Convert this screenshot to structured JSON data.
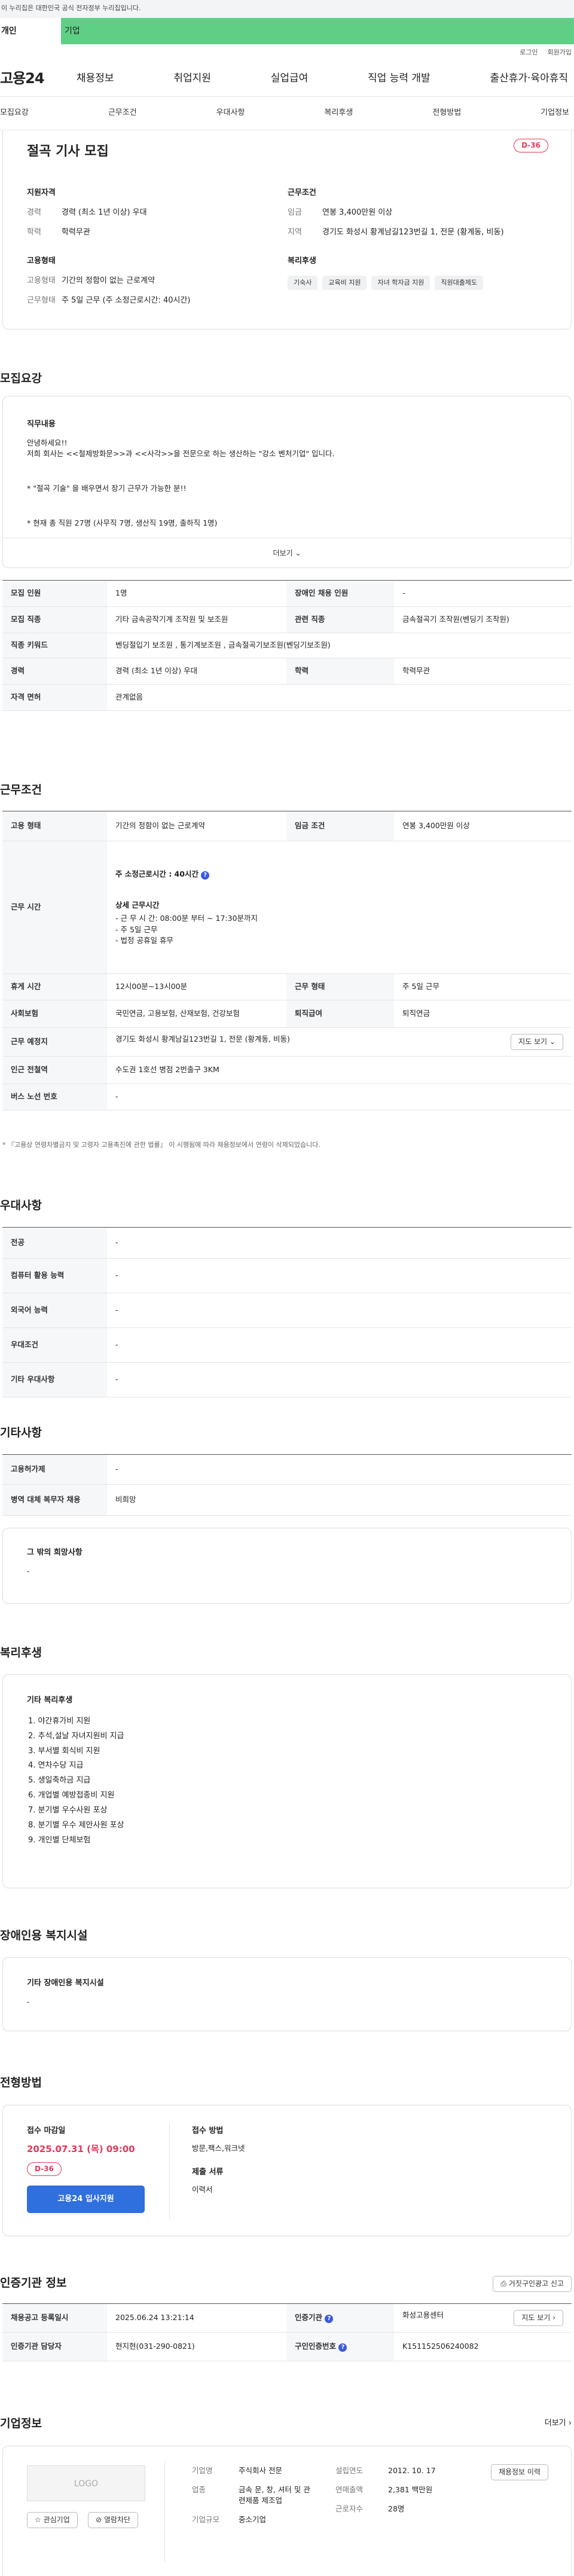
{
  "gov_banner": "이 누리집은 대한민국 공식 전자정부 누리집입니다.",
  "top_tabs": [
    "개인",
    "기업"
  ],
  "util_links": [
    "로그인",
    "회원가입"
  ],
  "site_logo": "고용24",
  "gnb": [
    "채용정보",
    "취업지원",
    "실업급여",
    "직업 능력 개발",
    "출산휴가·육아휴직"
  ],
  "anchors": [
    "모집요강",
    "근무조건",
    "우대사항",
    "복리후생",
    "전형방법",
    "기업정보"
  ],
  "job": {
    "title": "절곡 기사 모집",
    "dday": "D-36",
    "summary_left_title": "지원자격",
    "summary_left": [
      {
        "k": "경력",
        "v": "경력 (최소 1년 이상) 우대"
      },
      {
        "k": "학력",
        "v": "학력무관"
      }
    ],
    "employ_title": "고용형태",
    "employ": [
      {
        "k": "고용형태",
        "v": "기간의 정함이 없는 근로계약"
      },
      {
        "k": "근무형태",
        "v": "주 5일 근무 (주 소정근로시간: 40시간)"
      }
    ],
    "summary_right_title": "근무조건",
    "summary_right": [
      {
        "k": "임금",
        "v": "연봉 3,400만원 이상"
      },
      {
        "k": "지역",
        "v": "경기도 화성시 황계남길123번길 1, 전문 (황계동, 비동)"
      }
    ],
    "welfare_title": "복리후생",
    "welfare_chips": [
      "기숙사",
      "교육비 지원",
      "자녀 학자금 지원",
      "직원대출제도"
    ]
  },
  "recruit": {
    "heading": "모집요강",
    "duty_title": "직무내용",
    "duty_lines": [
      "안녕하세요!!",
      "저희 회사는 <<철제방화문>>과 <<사각>>을 전문으로 하는 생산하는 \"강소 벤처기업\" 입니다.",
      "* \"절곡 기술\" 을 배우면서 장기 근무가 가능한 분!!",
      "* 현재 총 직원 27명 (사무직 7명, 생산직 19명, 출하직 1명)"
    ],
    "more": "더보기",
    "rows": [
      [
        {
          "k": "모집 인원",
          "v": "1명"
        },
        {
          "k": "장애인 채용 인원",
          "v": "-"
        }
      ],
      [
        {
          "k": "모집 직종",
          "v": "기타 금속공작기계 조작원 및 보조원"
        },
        {
          "k": "관련 직종",
          "v": "금속절곡기 조작원(벤딩기 조작원)"
        }
      ],
      [
        {
          "k": "직종 키워드",
          "v": "벤딩절입기 보조원 , 통기계보조원 , 금속절곡기보조원(벤딩기보조원)"
        }
      ],
      [
        {
          "k": "경력",
          "v": "경력 (최소 1년 이상) 우대"
        },
        {
          "k": "학력",
          "v": "학력무관"
        }
      ],
      [
        {
          "k": "자격 면허",
          "v": "관계없음"
        }
      ]
    ]
  },
  "work": {
    "heading": "근무조건",
    "employ_k": "고용 형태",
    "employ_v": "기간의 정함이 없는 근로계약",
    "wage_k": "임금 조건",
    "wage_v": "연봉 3,400만원 이상",
    "hours_k": "근무 시간",
    "hours_weekly": "주 소정근로시간 : 40시간",
    "hours_detail_title": "상세 근무시간",
    "hours_detail": [
      "- 근 무 시 간: 08:00분 부터 ~ 17:30분까지",
      "- 주 5일 근무",
      "- 법정 공휴일 휴무"
    ],
    "rest_k": "휴게 시간",
    "rest_v": "12시00분~13시00분",
    "type_k": "근무 형태",
    "type_v": "주 5일 근무",
    "ins_k": "사회보험",
    "ins_v": "국민연금, 고용보험, 산재보험, 건강보험",
    "ret_k": "퇴직급여",
    "ret_v": "퇴직연금",
    "place_k": "근무 예정지",
    "place_v": "경기도 화성시 황계남길123번길 1, 전문 (황계동, 비동)",
    "map_btn": "지도 보기",
    "subway_k": "인근 전철역",
    "subway_v": "수도권 1호선 병점 2번출구 3KM",
    "bus_k": "버스 노선 번호",
    "bus_v": "-",
    "note": "* 『고용상 연령차별금지 및 고령자 고용촉진에 관한 법률』 이 시행됨에 따라 채용정보에서 연령이 삭제되었습니다."
  },
  "pref": {
    "heading": "우대사항",
    "rows": [
      {
        "k": "전공",
        "v": "-"
      },
      {
        "k": "컴퓨터 활용 능력",
        "v": "-"
      },
      {
        "k": "외국어 능력",
        "v": "-"
      },
      {
        "k": "우대조건",
        "v": "-"
      },
      {
        "k": "기타 우대사항",
        "v": "-"
      }
    ]
  },
  "etc": {
    "heading": "기타사항",
    "rows": [
      {
        "k": "고용허가제",
        "v": "-"
      },
      {
        "k": "병역 대체 복무자 채용",
        "v": "비희망"
      }
    ],
    "other_title": "그 밖의 희망사항",
    "other_v": "-"
  },
  "welfare": {
    "heading": "복리후생",
    "box_title": "기타 복리후생",
    "items": [
      "1. 야간휴가비 지원",
      "2. 추석,설날 자녀지원비 지급",
      "3. 부서별 회식비 지원",
      "4. 연차수당 지급",
      "5. 생일축하금 지급",
      "6. 개업별 예방접종비 지원",
      "7. 분기별 우수사원 포상",
      "8. 분기별 우수 제안사원 포상",
      "9. 개인별 단체보험"
    ]
  },
  "disabled": {
    "heading": "장애인용 복지시설",
    "box_title": "기타 장애인용 복지시설",
    "v": "-"
  },
  "selection": {
    "heading": "전형방법",
    "deadline_title": "접수 마감일",
    "deadline": "2025.07.31 (목) 09:00",
    "dday": "D-36",
    "apply_btn": "고용24 입사지원",
    "method_title": "접수 방법",
    "method_v": "방문,팩스,워크넷",
    "docs_title": "제출 서류",
    "docs_v": "이력서"
  },
  "cert": {
    "heading": "인증기관 정보",
    "report_btn": "거짓구인광고 신고",
    "reg_k": "채용공고 등록일시",
    "reg_v": "2025.06.24 13:21:14",
    "org_k": "인증기관",
    "org_v": "화성고용센터",
    "map_btn": "지도 보기",
    "mgr_k": "인증기관 담당자",
    "mgr_v": "현지현(031-290-0821)",
    "no_k": "구인인증번호",
    "no_v": "K151152506240082"
  },
  "company": {
    "heading": "기업정보",
    "more": "더보기",
    "logo": "LOGO",
    "fav_btn": "관심기업",
    "hide_btn": "열람차단",
    "type_k": "기업명",
    "type_v": "주식회사 전문",
    "ind_k": "업종",
    "ind_v": "금속 문, 창, 셔터 및 관련제품 제조업",
    "scale_k": "기업규모",
    "scale_v": "중소기업",
    "est_k": "설립연도",
    "est_v": "2012. 10. 17",
    "sales_k": "연매출액",
    "sales_v": "2,381 백만원",
    "emp_k": "근로자수",
    "emp_v": "28명",
    "job_btn": "채용정보 이력"
  }
}
